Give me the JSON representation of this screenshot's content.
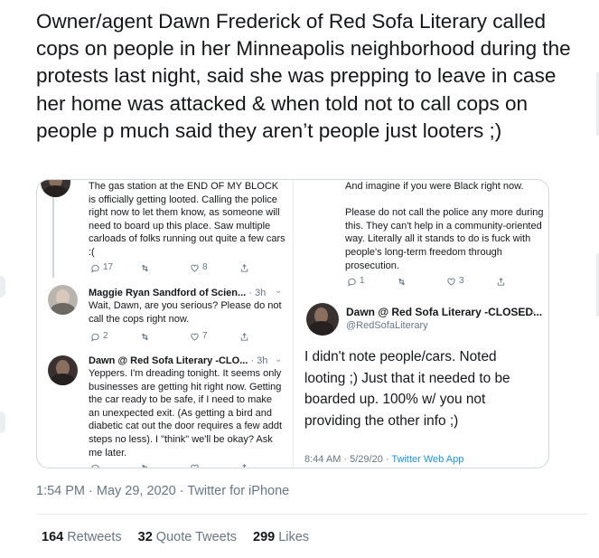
{
  "tweet": {
    "text": "Owner/agent Dawn Frederick of Red Sofa Literary called cops on people in her Minneapolis neighborhood during the protests last night, said she was prepping to leave in case her home was attacked & when told not to call cops on people p much said they aren’t people just looters ;)",
    "timestamp": "1:54 PM · May 29, 2020 · Twitter for iPhone",
    "stats": {
      "retweets_count": "164",
      "retweets_label": "Retweets",
      "quotes_count": "32",
      "quotes_label": "Quote Tweets",
      "likes_count": "299",
      "likes_label": "Likes"
    }
  },
  "screenshot_left": {
    "tweet1": {
      "text": "The gas station at the END OF MY BLOCK is officially getting looted. Calling the police right now to let them know, as someone will need to board up this place. Saw multiple carloads of folks running out quite  a few cars :(",
      "replies": "17",
      "likes": "8"
    },
    "tweet2": {
      "name": "Maggie Ryan Sandford of Scien...",
      "time": "· 3h",
      "text": "Wait, Dawn, are you serious? Please do not call the cops right now.",
      "replies": "2",
      "likes": "7"
    },
    "tweet3": {
      "name": "Dawn @ Red Sofa Literary -CLO...",
      "time": "· 3h",
      "text": "Yeppers. I'm dreading tonight. It seems only businesses are getting hit right now. Getting the car ready to be safe, if I need to make an unexpected exit. (As getting a bird and diabetic cat out the door requires a few addt steps no less).  I \"think\" we'll be okay? Ask me later."
    }
  },
  "screenshot_right": {
    "top_text": "And imagine if you were Black right now.\n\nPlease do not call the police any more during this. They can't help in a community-oriented way. Literally all it stands to do is fuck with people's long-term freedom through prosecution.",
    "top_replies": "1",
    "top_likes": "3",
    "name": "Dawn @ Red Sofa Literary -CLOSED...",
    "handle": "@RedSofaLiterary",
    "body": "I didn't note people/cars. Noted looting ;)  Just that it needed to be boarded up. 100% w/ you not providing the other info ;)",
    "footer_time": "8:44 AM · 5/29/20 · ",
    "footer_source": "Twitter Web App"
  }
}
